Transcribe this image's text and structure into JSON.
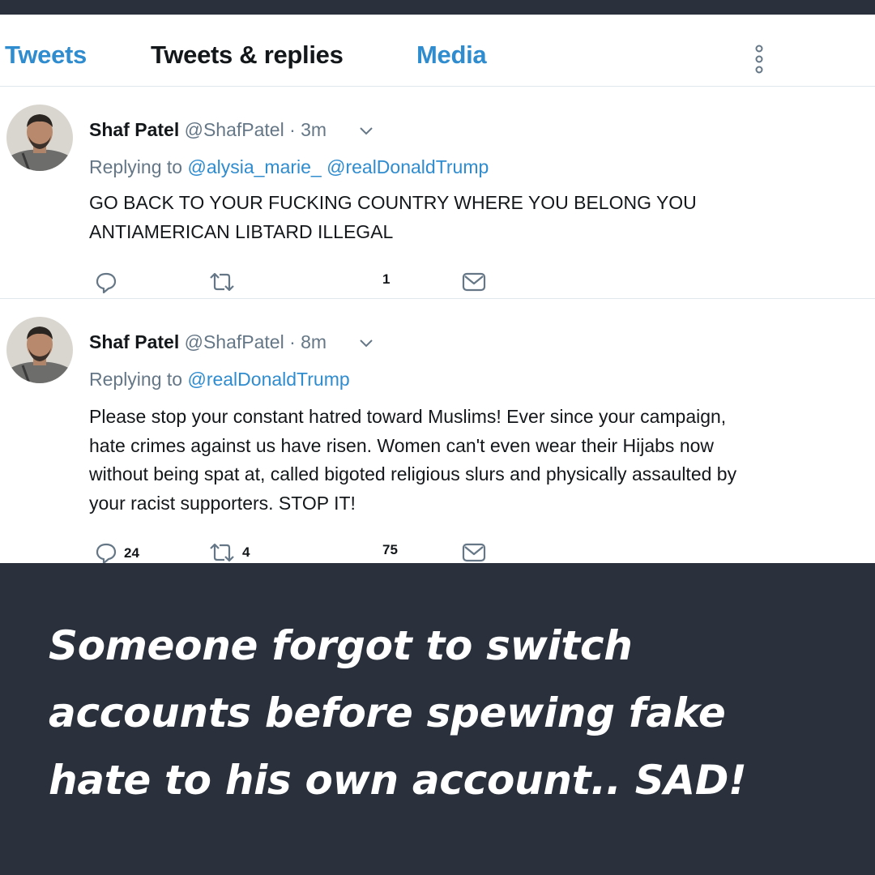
{
  "tabs": {
    "tweets": "Tweets",
    "tweets_replies": "Tweets & replies",
    "media": "Media"
  },
  "tweets": [
    {
      "name": "Shaf Patel",
      "handle": "@ShafPatel",
      "time": "· 3m",
      "replying_prefix": "Replying to",
      "mentions": [
        "@alysia_marie_",
        "@realDonaldTrump"
      ],
      "text_lines": [
        "GO BACK TO YOUR FUCKING COUNTRY WHERE YOU BELONG YOU",
        "ANTIAMERICAN LIBTARD ILLEGAL"
      ],
      "replies": "",
      "retweets": "",
      "likes": "1"
    },
    {
      "name": "Shaf Patel",
      "handle": "@ShafPatel",
      "time": "· 8m",
      "replying_prefix": "Replying to",
      "mentions": [
        "@realDonaldTrump"
      ],
      "text_lines": [
        "Please stop your constant hatred toward Muslims! Ever since your campaign,",
        "hate crimes against us have risen. Women can't even wear their Hijabs now",
        "without being spat at, called bigoted religious slurs and physically assaulted by",
        "your racist supporters. STOP IT!"
      ],
      "replies": "24",
      "retweets": "4",
      "likes": "75"
    }
  ],
  "caption_lines": [
    "Someone forgot to switch",
    "accounts before spewing fake",
    "hate to his own account.. SAD!"
  ],
  "colors": {
    "link_blue": "#2f8ccf",
    "caption_background": "#2b313c",
    "muted_text": "#657786"
  }
}
